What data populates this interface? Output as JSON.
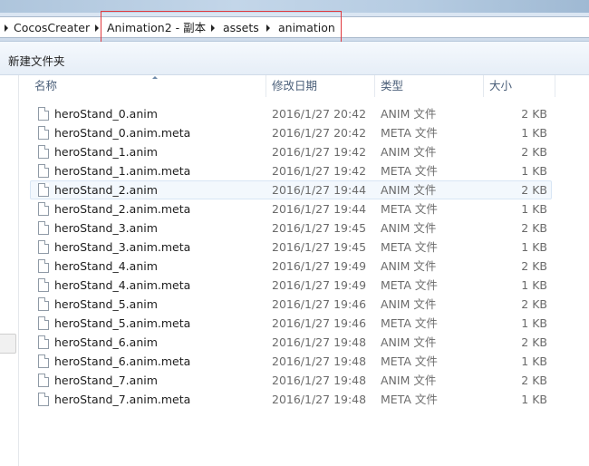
{
  "breadcrumb": {
    "items": [
      "CocosCreater",
      "Animation2 - 副本",
      "assets",
      "animation"
    ]
  },
  "toolbar": {
    "new_folder_label": "新建文件夹"
  },
  "columns": {
    "name": "名称",
    "date": "修改日期",
    "type": "类型",
    "size": "大小"
  },
  "files": [
    {
      "name": "heroStand_0.anim",
      "date": "2016/1/27 20:42",
      "type": "ANIM 文件",
      "size": "2 KB"
    },
    {
      "name": "heroStand_0.anim.meta",
      "date": "2016/1/27 20:42",
      "type": "META 文件",
      "size": "1 KB"
    },
    {
      "name": "heroStand_1.anim",
      "date": "2016/1/27 19:42",
      "type": "ANIM 文件",
      "size": "2 KB"
    },
    {
      "name": "heroStand_1.anim.meta",
      "date": "2016/1/27 19:42",
      "type": "META 文件",
      "size": "1 KB"
    },
    {
      "name": "heroStand_2.anim",
      "date": "2016/1/27 19:44",
      "type": "ANIM 文件",
      "size": "2 KB"
    },
    {
      "name": "heroStand_2.anim.meta",
      "date": "2016/1/27 19:44",
      "type": "META 文件",
      "size": "1 KB"
    },
    {
      "name": "heroStand_3.anim",
      "date": "2016/1/27 19:45",
      "type": "ANIM 文件",
      "size": "2 KB"
    },
    {
      "name": "heroStand_3.anim.meta",
      "date": "2016/1/27 19:45",
      "type": "META 文件",
      "size": "1 KB"
    },
    {
      "name": "heroStand_4.anim",
      "date": "2016/1/27 19:49",
      "type": "ANIM 文件",
      "size": "2 KB"
    },
    {
      "name": "heroStand_4.anim.meta",
      "date": "2016/1/27 19:49",
      "type": "META 文件",
      "size": "1 KB"
    },
    {
      "name": "heroStand_5.anim",
      "date": "2016/1/27 19:46",
      "type": "ANIM 文件",
      "size": "2 KB"
    },
    {
      "name": "heroStand_5.anim.meta",
      "date": "2016/1/27 19:46",
      "type": "META 文件",
      "size": "1 KB"
    },
    {
      "name": "heroStand_6.anim",
      "date": "2016/1/27 19:48",
      "type": "ANIM 文件",
      "size": "2 KB"
    },
    {
      "name": "heroStand_6.anim.meta",
      "date": "2016/1/27 19:48",
      "type": "META 文件",
      "size": "1 KB"
    },
    {
      "name": "heroStand_7.anim",
      "date": "2016/1/27 19:48",
      "type": "ANIM 文件",
      "size": "2 KB"
    },
    {
      "name": "heroStand_7.anim.meta",
      "date": "2016/1/27 19:48",
      "type": "META 文件",
      "size": "1 KB"
    }
  ],
  "selected_file": "heroStand_2.anim",
  "colors": {
    "highlight_border": "#e0393e",
    "selection_bg": "#f3f8fd",
    "header_text": "#4c607a"
  },
  "icons": {
    "breadcrumb_separator": "triangle-right-icon",
    "file": "file-icon",
    "sort": "sort-up-icon"
  }
}
